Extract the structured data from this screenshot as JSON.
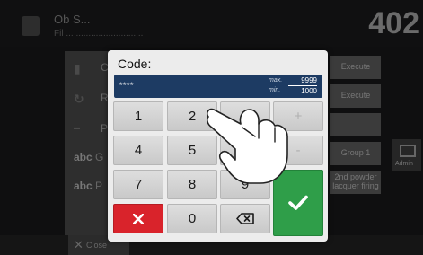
{
  "topbar": {
    "line1": "Ob S...",
    "line2": "Fil ... ...........................",
    "temperature": "402"
  },
  "background_rows": [
    {
      "icon": "program-icon",
      "label": "C"
    },
    {
      "icon": "refresh-icon",
      "label": "R"
    },
    {
      "icon": "badge-icon",
      "label": "P"
    },
    {
      "abbr": "abc",
      "label": "G"
    },
    {
      "abbr": "abc",
      "label": "P"
    }
  ],
  "background_buttons": [
    "Execute",
    "Execute",
    "",
    "Group 1",
    "2nd powder\nlacquer firing"
  ],
  "side_button": {
    "label": "Admin"
  },
  "bottombar": {
    "close_label": "Close"
  },
  "dialog": {
    "title": "Code:",
    "value": "****",
    "max_label": "max.",
    "max_value": "9999",
    "min_label": "min.",
    "min_value": "1000"
  },
  "keypad": {
    "rows": [
      [
        "1",
        "2",
        "3",
        "+"
      ],
      [
        "4",
        "5",
        "6",
        "-"
      ],
      [
        "7",
        "8",
        "9"
      ],
      [
        "",
        "0",
        ""
      ]
    ]
  },
  "colors": {
    "display_bg": "#1d3b63",
    "cancel": "#d9232b",
    "confirm": "#2f9e49",
    "key_bg": "#d4d4d4"
  }
}
